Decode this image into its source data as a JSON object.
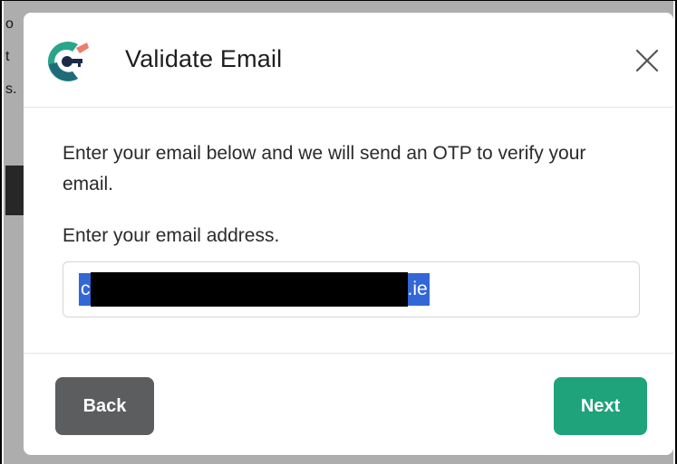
{
  "background": {
    "fragments": [
      "o",
      "t",
      "s."
    ]
  },
  "modal": {
    "title": "Validate Email",
    "close_icon": "close-icon",
    "instruction": "Enter your email below and we will send an OTP to verify your email.",
    "field_label": "Enter your email address.",
    "email_input": {
      "value_start": "c",
      "value_end": ".ie"
    },
    "back_label": "Back",
    "next_label": "Next"
  },
  "colors": {
    "next_button": "#1fa37a",
    "back_button": "#5b5d5f",
    "selection": "#3367d6",
    "logo_teal": "#2aa58a",
    "logo_navy": "#1c2a4a",
    "logo_coral": "#e8806c"
  }
}
